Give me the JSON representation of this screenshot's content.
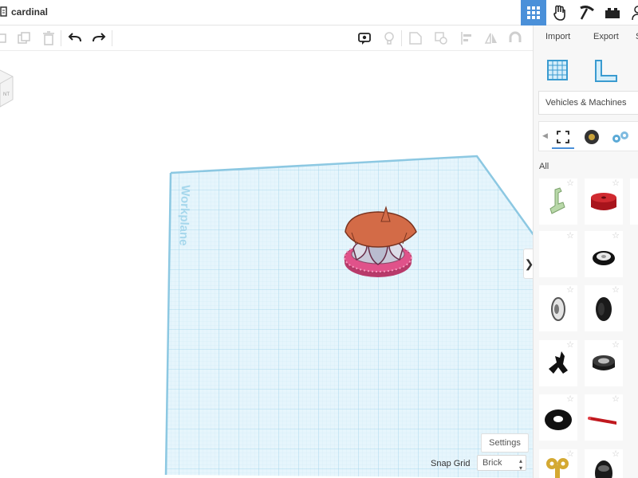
{
  "header": {
    "doc_title": "cardinal",
    "modes": [
      "3d-design-icon",
      "codeblocks-icon",
      "minecraft-icon",
      "lego-brick-icon",
      "user-icon"
    ]
  },
  "toolbar": {
    "buttons": [
      "copy-icon",
      "duplicate-icon",
      "delete-icon",
      "undo-icon",
      "redo-icon",
      "comment-icon",
      "light-icon",
      "group-icon",
      "ungroup-icon",
      "align-icon",
      "mirror-icon",
      "hide-icon"
    ]
  },
  "viewport": {
    "workplane_label": "Workplane",
    "viewcube_face": "NT",
    "settings_label": "Settings",
    "snap_grid_label": "Snap Grid",
    "snap_grid_value": "Brick"
  },
  "panel": {
    "import_label": "Import",
    "export_label": "Export",
    "share_label": "S",
    "library": "Vehicles & Machines",
    "category_all": "All",
    "shapes": [
      "green-lever-shape",
      "red-cylinder-shape",
      "blank-shape",
      "small-tire-shape",
      "white-rim-wheel-shape",
      "black-wheel-shape",
      "black-connector-shape",
      "grey-wheel-shape",
      "black-ring-shape",
      "red-axle-shape",
      "gold-key-shape",
      "dark-wheel-shape"
    ]
  },
  "colors": {
    "accent": "#4a90d9",
    "grid": "#bfe4f5",
    "canopy": "#d36b47",
    "base": "#e0528a"
  }
}
